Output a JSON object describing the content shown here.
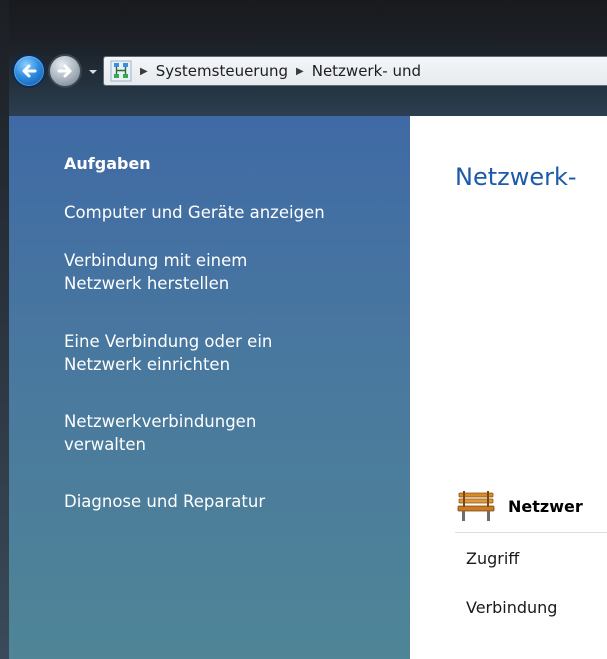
{
  "titlebar": {
    "back_button": "back-arrow",
    "forward_button": "forward-arrow",
    "history_dropdown": "chevron-down"
  },
  "address_bar": {
    "icon": "network-icon",
    "breadcrumbs": [
      "Systemsteuerung",
      "Netzwerk- und"
    ]
  },
  "sidebar": {
    "heading": "Aufgaben",
    "items": [
      {
        "label": "Computer und Geräte anzeigen"
      },
      {
        "label": "Verbindung mit einem Netzwerk herstellen"
      },
      {
        "label": "Eine Verbindung oder ein Netzwerk einrichten"
      },
      {
        "label": "Netzwerkverbindungen verwalten"
      },
      {
        "label": "Diagnose und Reparatur"
      }
    ]
  },
  "main": {
    "title": "Netzwerk-",
    "section": {
      "icon": "park-bench-icon",
      "title": "Netzwer",
      "rows": [
        {
          "label": "Zugriff"
        },
        {
          "label": "Verbindung"
        }
      ]
    }
  },
  "colors": {
    "sidebar_top": "#3f6aa5",
    "sidebar_bottom": "#4f8596",
    "title_blue": "#1e5aa8",
    "titlebar": "#1b1f25"
  }
}
